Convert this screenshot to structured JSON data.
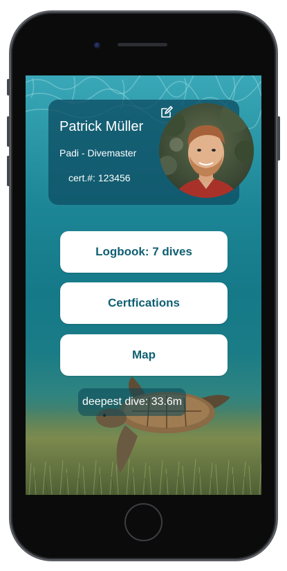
{
  "profile": {
    "name": "Patrick Müller",
    "rank": "Padi - Divemaster",
    "cert_label": "cert.#:",
    "cert_number": "123456"
  },
  "buttons": {
    "logbook_prefix": "Logbook:",
    "logbook_count": "7 dives",
    "certifications": "Certfications",
    "map": "Map"
  },
  "stats": {
    "deepest_label": "deepest dive:",
    "deepest_value": "33.6m"
  },
  "colors": {
    "accent": "#0f5f72",
    "card_bg": "#0e4e64",
    "button_bg": "#ffffff"
  },
  "icons": {
    "edit": "pencil-square-icon"
  }
}
